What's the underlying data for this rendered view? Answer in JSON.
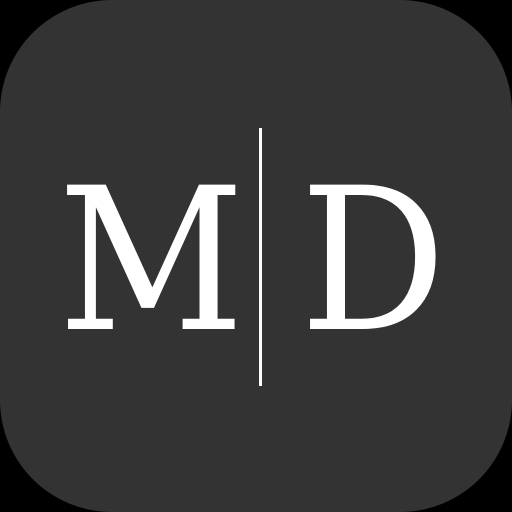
{
  "logo": {
    "letter_left": "M",
    "letter_right": "D",
    "colors": {
      "tile": "#333333",
      "foreground": "#ffffff",
      "background": "#000000"
    }
  }
}
